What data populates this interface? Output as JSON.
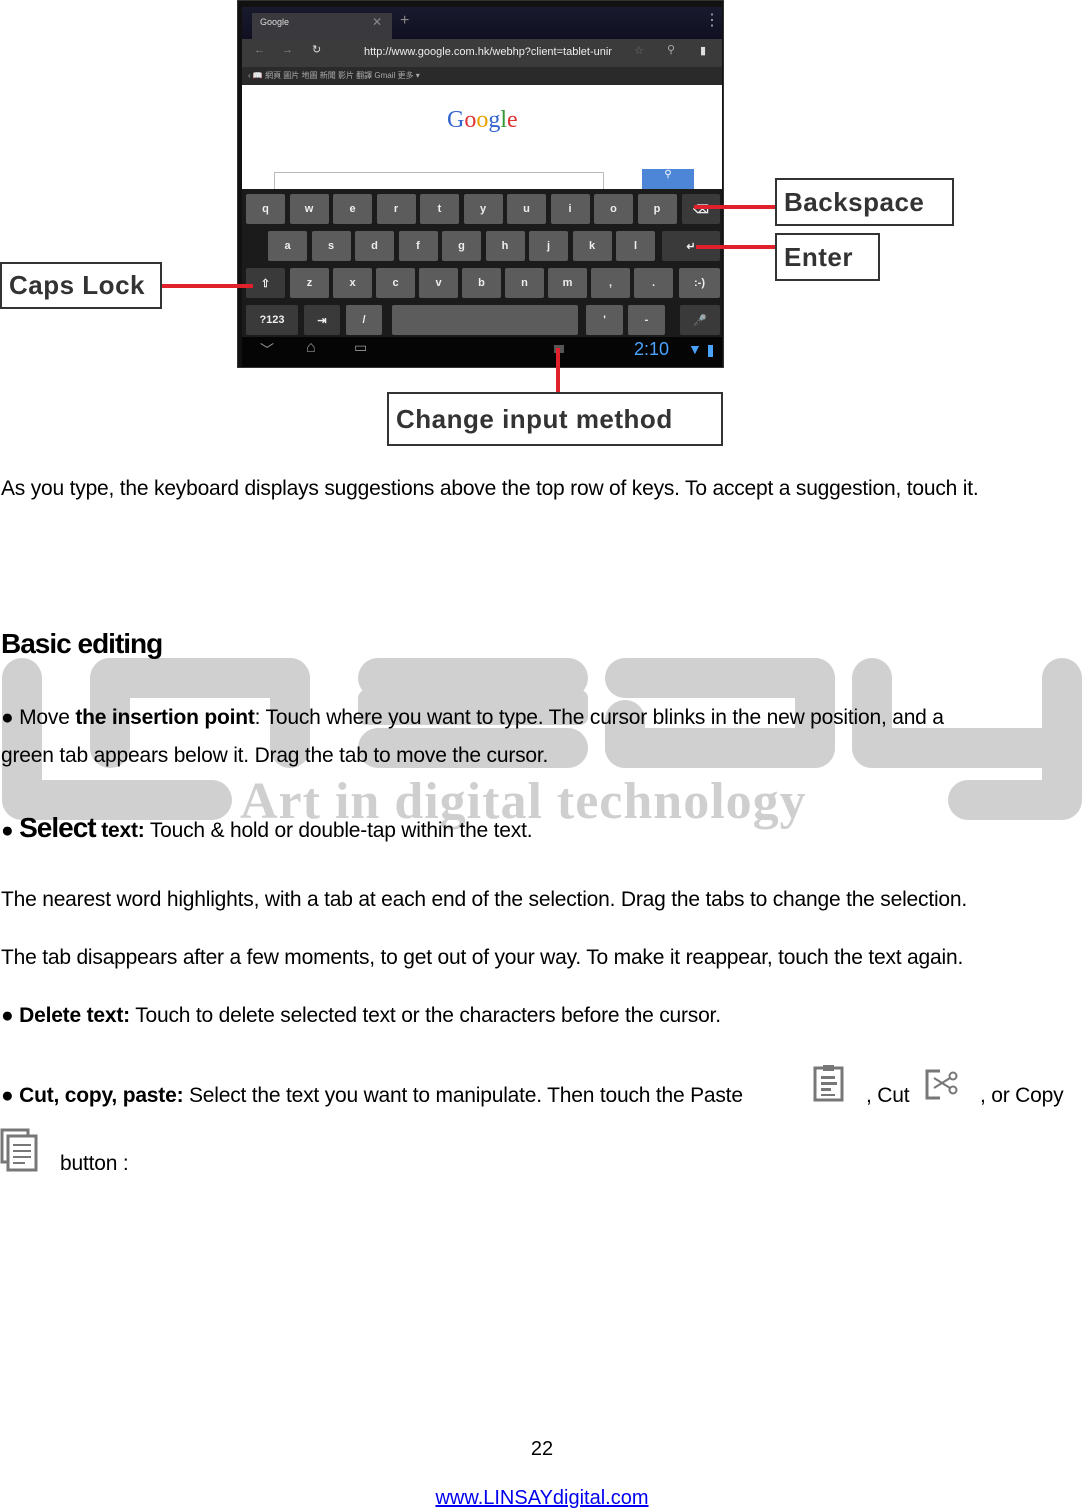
{
  "figure": {
    "browser": {
      "tab_title": "Google",
      "url": "http://www.google.com.hk/webhp?client=tablet-unir",
      "bookmarks": "‹ 📖 網頁 圖片 地圖 新聞 影片 翻譯 Gmail 更多 ▾",
      "logo": "Google",
      "clock": "2:10"
    },
    "keyboard": {
      "row1": [
        "q",
        "w",
        "e",
        "r",
        "t",
        "y",
        "u",
        "i",
        "o",
        "p"
      ],
      "row2": [
        "a",
        "s",
        "d",
        "f",
        "g",
        "h",
        "j",
        "k",
        "l"
      ],
      "row3": [
        "z",
        "x",
        "c",
        "v",
        "b",
        "n",
        "m",
        ",",
        "."
      ],
      "smiley": ":-)",
      "sym": "?123",
      "slash": "/",
      "apos": "'",
      "dash": "-"
    },
    "callouts": {
      "backspace": "Backspace",
      "enter": "Enter",
      "caps_lock": "Caps Lock",
      "change_input": "Change input method"
    },
    "callout_color": "#e0202a"
  },
  "body": {
    "intro": "As you type, the keyboard displays suggestions above the top row of keys. To accept a suggestion, touch it.",
    "heading": "Basic editing",
    "move": {
      "bullet": "●",
      "lead": "Move ",
      "bold": "the insertion point",
      "rest": ": Touch where you want to type. The cursor blinks in the new position, and a",
      "line2": "green tab appears below it. Drag the tab to move the cursor."
    },
    "select": {
      "bullet": "●",
      "bold_big": "Select",
      "bold": " text:",
      "rest": " Touch & hold or double-tap within the text."
    },
    "nearest": "The nearest word highlights, with a tab at each end of the selection. Drag the tabs to change the selection.",
    "tab_disappears": "The tab disappears after a few moments, to get out of your way. To make it reappear, touch the text again.",
    "delete": {
      "bullet": "●",
      "bold": "Delete text:",
      "rest": " Touch to delete selected text or the characters before the cursor."
    },
    "ccp": {
      "bullet": "●",
      "bold": "Cut, copy, paste:",
      "rest": " Select the text you want to manipulate. Then touch the Paste",
      "cut": ", Cut",
      "copy": ", or Copy",
      "button": "button :"
    }
  },
  "watermark": {
    "brand": "LINSAY",
    "tagline": "Art in digital technology"
  },
  "footer": {
    "page_number": "22",
    "url": "www.LINSAYdigital.com",
    "link_color": "#0000ee"
  }
}
